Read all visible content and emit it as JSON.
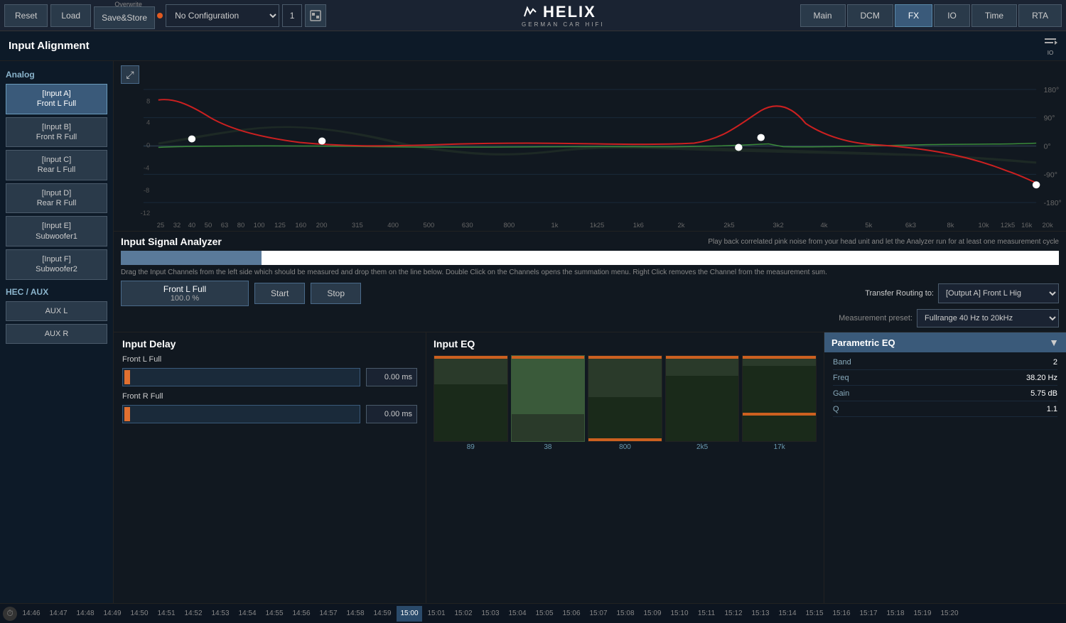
{
  "topbar": {
    "reset_label": "Reset",
    "load_label": "Load",
    "overwrite_label": "Overwrite",
    "save_store_label": "Save&Store",
    "config_placeholder": "No Configuration",
    "config_num": "1",
    "nav_tabs": [
      {
        "id": "main",
        "label": "Main",
        "active": false
      },
      {
        "id": "dcm",
        "label": "DCM",
        "active": false
      },
      {
        "id": "fx",
        "label": "FX",
        "active": true
      },
      {
        "id": "io",
        "label": "IO",
        "active": false
      },
      {
        "id": "time",
        "label": "Time",
        "active": false
      },
      {
        "id": "rta",
        "label": "RTA",
        "active": false
      }
    ],
    "logo_text": "HELIX",
    "logo_sub": "German Car HiFi"
  },
  "page_title": "Input Alignment",
  "sidebar": {
    "analog_label": "Analog",
    "hec_aux_label": "HEC / AUX",
    "analog_inputs": [
      {
        "id": "A",
        "label": "[Input A]\nFront L Full",
        "active": true
      },
      {
        "id": "B",
        "label": "[Input B]\nFront R Full",
        "active": false
      },
      {
        "id": "C",
        "label": "[Input C]\nRear L Full",
        "active": false
      },
      {
        "id": "D",
        "label": "[Input D]\nRear R Full",
        "active": false
      },
      {
        "id": "E",
        "label": "[Input E]\nSubwoofer1",
        "active": false
      },
      {
        "id": "F",
        "label": "[Input F]\nSubwoofer2",
        "active": false
      }
    ],
    "aux_inputs": [
      {
        "id": "AUXL",
        "label": "AUX L",
        "active": false
      },
      {
        "id": "AUXR",
        "label": "AUX R",
        "active": false
      }
    ]
  },
  "graph": {
    "y_labels": [
      "180°",
      "90°",
      "0°",
      "-90°",
      "-180°"
    ],
    "x_labels": [
      "25",
      "32",
      "40",
      "50",
      "63",
      "80",
      "100",
      "125",
      "160",
      "200",
      "315",
      "400",
      "500",
      "630",
      "800",
      "1k",
      "1k25",
      "1k6",
      "2k",
      "2k5",
      "3k2",
      "4k",
      "5k",
      "6k3",
      "8k",
      "10k",
      "12k5",
      "16k",
      "20k"
    ]
  },
  "signal_analyzer": {
    "title": "Input Signal Analyzer",
    "hint": "Play back correlated pink noise from your head unit and let the Analyzer run for at least one measurement cycle",
    "drag_hint": "Drag the Input Channels from the left side which should be measured and drop them on the line below. Double Click on the Channels opens the summation menu. Right Click removes the Channel from the measurement sum.",
    "progress_pct": 15,
    "channel_name": "Front L Full",
    "channel_pct": "100.0 %",
    "start_label": "Start",
    "stop_label": "Stop",
    "transfer_label": "Transfer Routing to:",
    "transfer_value": "[Output A] Front L Hig",
    "preset_label": "Measurement preset:",
    "preset_value": "Fullrange 40 Hz to 20kHz"
  },
  "input_delay": {
    "title": "Input Delay",
    "channels": [
      {
        "label": "Front L Full",
        "value": "0.00 ms"
      },
      {
        "label": "Front R Full",
        "value": "0.00 ms"
      }
    ]
  },
  "input_eq": {
    "title": "Input EQ",
    "bands": [
      {
        "freq": "89",
        "height_pct": 30
      },
      {
        "freq": "38",
        "height_pct": 65
      },
      {
        "freq": "800",
        "height_pct": 45
      },
      {
        "freq": "2k5",
        "height_pct": 20
      },
      {
        "freq": "17k",
        "height_pct": 55
      }
    ]
  },
  "parametric_eq": {
    "title": "Parametric EQ",
    "params": [
      {
        "label": "Band",
        "value": "2"
      },
      {
        "label": "Freq",
        "value": "38.20 Hz"
      },
      {
        "label": "Gain",
        "value": "5.75 dB"
      },
      {
        "label": "Q",
        "value": "1.1"
      }
    ]
  },
  "time_bar": {
    "times": [
      "14:46",
      "14:47",
      "14:48",
      "14:49",
      "14:50",
      "14:51",
      "14:52",
      "14:53",
      "14:54",
      "14:55",
      "14:56",
      "14:57",
      "14:58",
      "14:59",
      "15:00",
      "15:01",
      "15:02",
      "15:03",
      "15:04",
      "15:05",
      "15:06",
      "15:07",
      "15:08",
      "15:09",
      "15:10",
      "15:11",
      "15:12",
      "15:13",
      "15:14",
      "15:15",
      "15:16",
      "15:17",
      "15:18",
      "15:19",
      "15:20"
    ],
    "active_time": "15:00"
  }
}
